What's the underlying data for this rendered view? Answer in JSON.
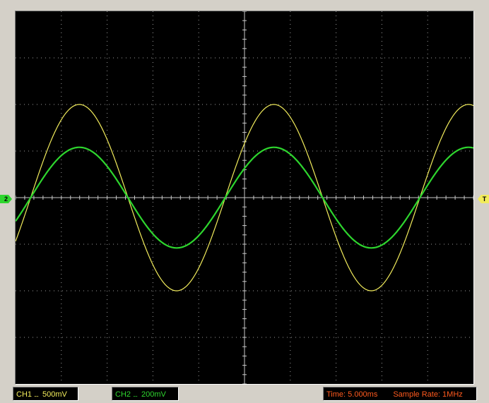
{
  "window": {
    "background": "#d4d0c8",
    "screen_background": "#000000",
    "grid_color": "#9a9a9a"
  },
  "markers": {
    "ch2": "2",
    "trigger": "T"
  },
  "status": {
    "ch1_label": "CH1",
    "ch1_coupling": "....",
    "ch1_scale": "500mV",
    "ch2_label": "CH2",
    "ch2_coupling": "....",
    "ch2_scale": "200mV",
    "time": "Time: 5.000ms",
    "sample_rate": "Sample Rate: 1MHz"
  },
  "waveforms": {
    "grid_divisions": {
      "horizontal": 10,
      "vertical": 8
    },
    "channels": [
      {
        "name": "CH1",
        "color": "#f2ec5c",
        "amplitude_div": 2.0,
        "period_div": 4.25,
        "phase_div": -0.42,
        "offset_div": 0
      },
      {
        "name": "CH2",
        "color": "#2ed62e",
        "amplitude_div": 1.08,
        "period_div": 4.25,
        "phase_div": -0.42,
        "offset_div": 0
      }
    ]
  }
}
